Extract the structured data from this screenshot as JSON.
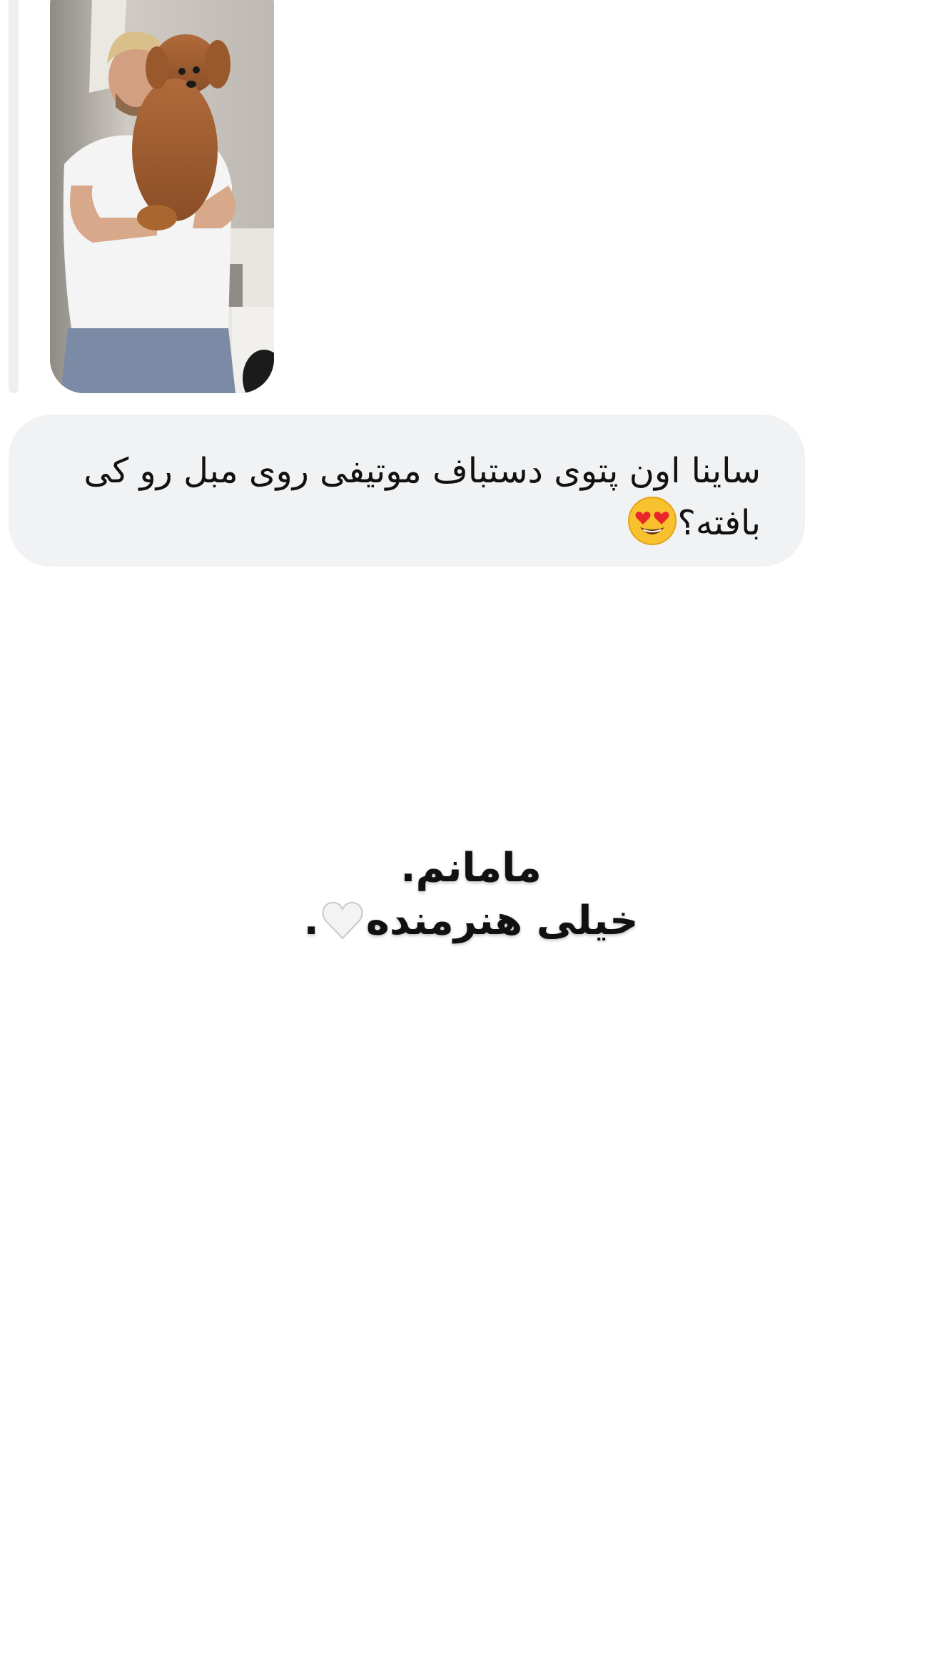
{
  "replied_media": {
    "icon": "photo-man-holding-dog",
    "alt": "Man in white t-shirt holding a brown curly dog"
  },
  "message": {
    "text": "ساینا اون پتوی دستباف موتیفی روی مبل رو کی بافته؟",
    "emoji": "smiling-face-with-heart-eyes-icon"
  },
  "caption": {
    "line1": "مامانم.",
    "line2_text": "خیلی هنرمنده",
    "line2_emoji": "white-heart-icon",
    "line2_end": "."
  },
  "colors": {
    "bubble_bg": "#f1f2f4",
    "text": "#111111",
    "reply_bar": "#eeeff1"
  }
}
